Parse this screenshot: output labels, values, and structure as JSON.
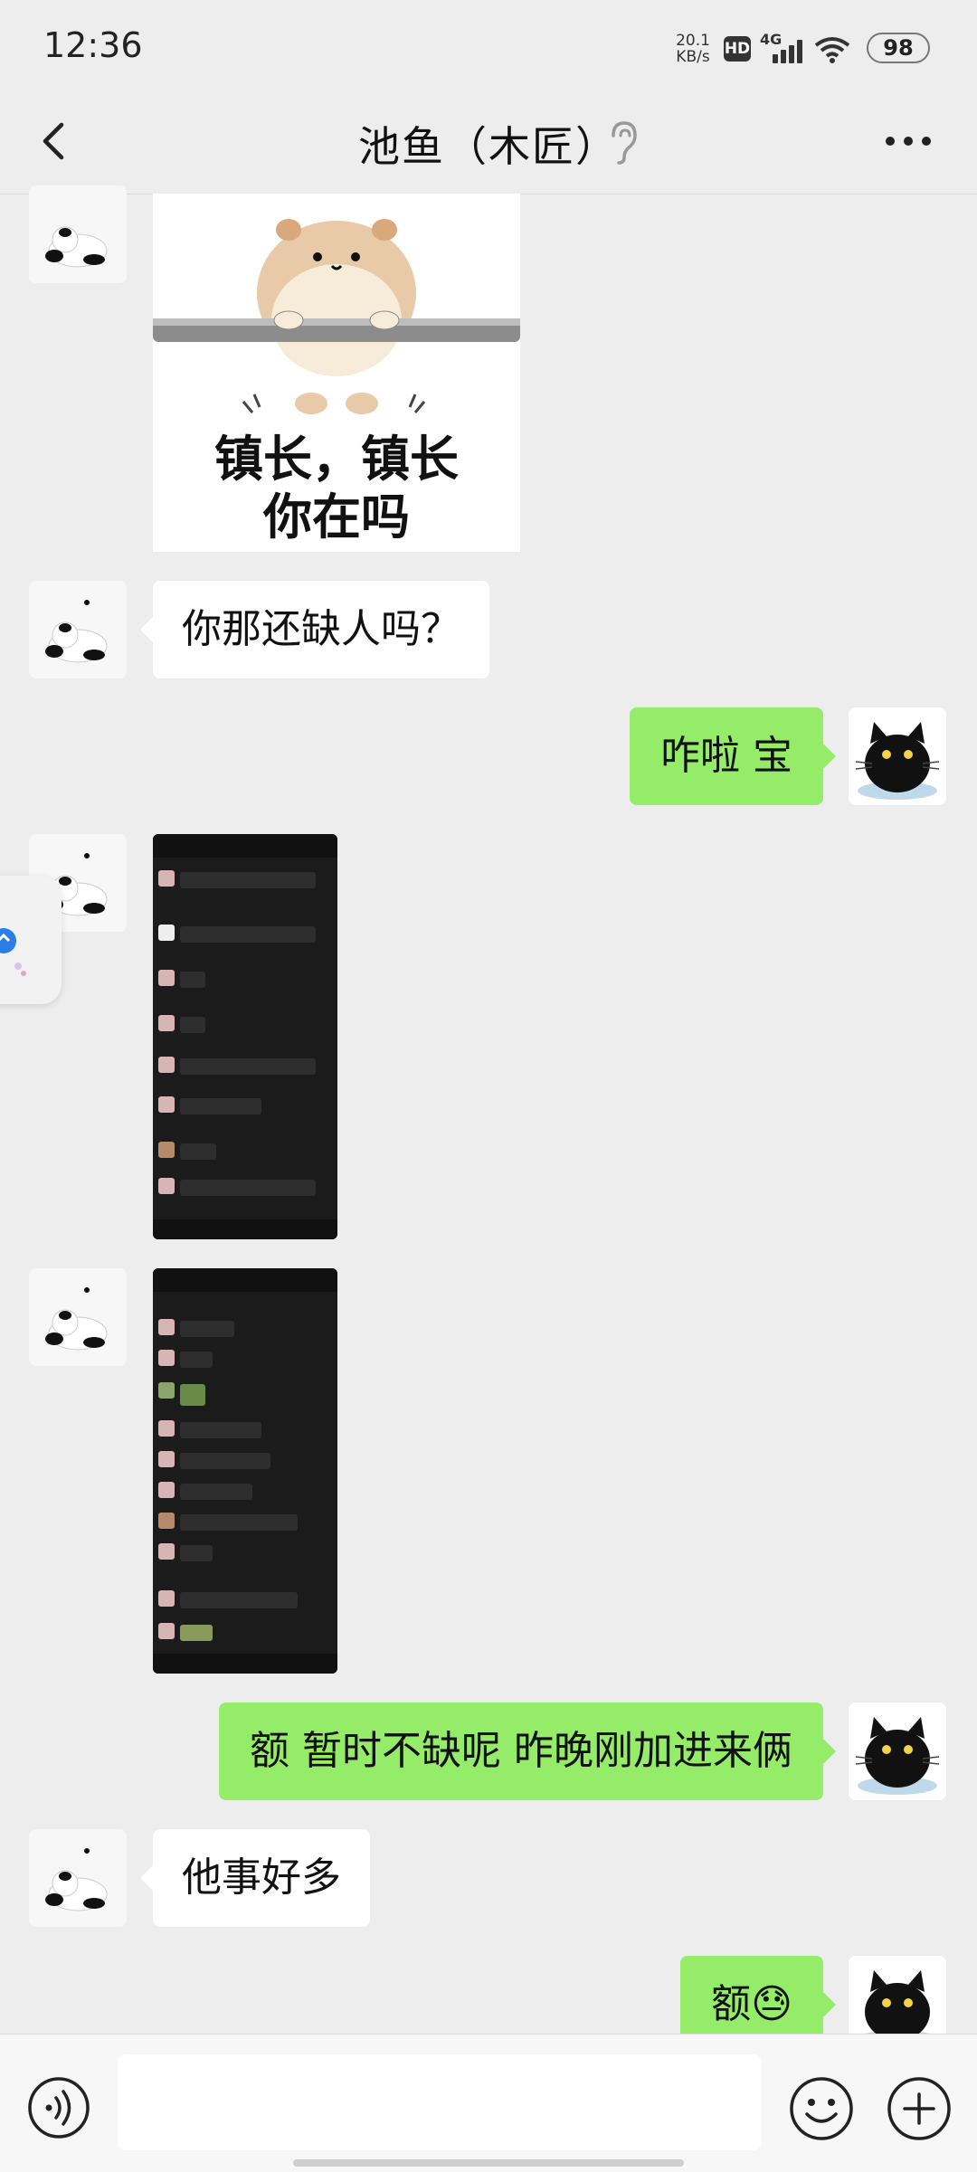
{
  "status_bar": {
    "time": "12:36",
    "net_speed_value": "20.1",
    "net_speed_unit": "KB/s",
    "hd": "HD",
    "network": "4G",
    "battery": "98"
  },
  "header": {
    "title": "池鱼（木匠）"
  },
  "messages": {
    "sticker_line1": "镇长，镇长",
    "sticker_line2": "你在吗",
    "m1": "你那还缺人吗？",
    "m2": "咋啦 宝",
    "m3": "额 暂时不缺呢 昨晚刚加进来俩",
    "m4": "他事好多",
    "m5": "额😓"
  },
  "input": {
    "placeholder": ""
  },
  "colors": {
    "background": "#ededed",
    "incoming_bubble": "#ffffff",
    "outgoing_bubble": "#95ec69"
  },
  "icons": {
    "back": "back-arrow-icon",
    "ear": "ear-icon",
    "more": "more-icon",
    "voice": "voice-icon",
    "emoji": "emoji-icon",
    "plus": "plus-icon"
  }
}
